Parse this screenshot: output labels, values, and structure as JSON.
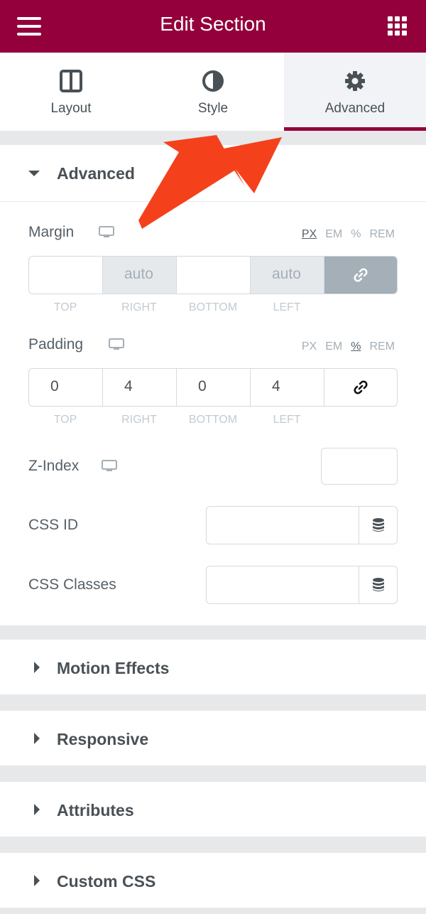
{
  "header": {
    "title": "Edit Section"
  },
  "tabs": [
    {
      "label": "Layout"
    },
    {
      "label": "Style"
    },
    {
      "label": "Advanced"
    }
  ],
  "advanced_section": {
    "title": "Advanced",
    "margin": {
      "label": "Margin",
      "units": [
        "PX",
        "EM",
        "%",
        "REM"
      ],
      "selected_unit": "PX",
      "values": {
        "top": "",
        "right": "auto",
        "bottom": "",
        "left": "auto"
      },
      "linked": true
    },
    "padding": {
      "label": "Padding",
      "units": [
        "PX",
        "EM",
        "%",
        "REM"
      ],
      "selected_unit": "%",
      "values": {
        "top": "0",
        "right": "4",
        "bottom": "0",
        "left": "4"
      },
      "linked": false
    },
    "dimension_labels": [
      "TOP",
      "RIGHT",
      "BOTTOM",
      "LEFT"
    ],
    "z_index": {
      "label": "Z-Index",
      "value": ""
    },
    "css_id": {
      "label": "CSS ID",
      "value": ""
    },
    "css_classes": {
      "label": "CSS Classes",
      "value": ""
    }
  },
  "collapsed_sections": [
    {
      "title": "Motion Effects"
    },
    {
      "title": "Responsive"
    },
    {
      "title": "Attributes"
    },
    {
      "title": "Custom CSS"
    }
  ],
  "colors": {
    "brand": "#93003c",
    "annotation_arrow": "#f4411c"
  }
}
